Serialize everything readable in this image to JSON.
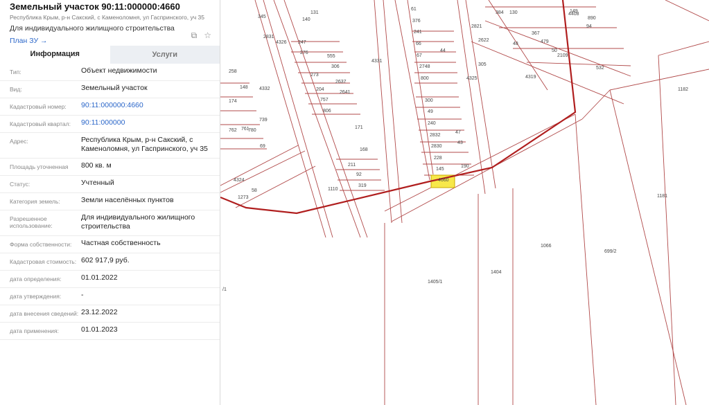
{
  "header": {
    "title": "Земельный участок 90:11:000000:4660",
    "address_short": "Республика Крым, р-н Сакский, с Каменоломня, ул Гаспринского, уч 35",
    "purpose": "Для индивидуального жилищного строительства",
    "plan_link": "План ЗУ →"
  },
  "tabs": [
    {
      "label": "Информация",
      "active": true
    },
    {
      "label": "Услуги",
      "active": false
    }
  ],
  "rows": [
    {
      "label": "Тип:",
      "value": "Объект недвижимости"
    },
    {
      "label": "Вид:",
      "value": "Земельный участок"
    },
    {
      "label": "Кадастровый номер:",
      "value": "90:11:000000:4660",
      "link": true
    },
    {
      "label": "Кадастровый квартал:",
      "value": "90:11:000000",
      "link": true
    },
    {
      "label": "Адрес:",
      "value": "Республика Крым, р-н Сакский, с Каменоломня, ул Гаспринского, уч 35"
    },
    {
      "label": "Площадь уточненная",
      "value": "800 кв. м"
    },
    {
      "label": "Статус:",
      "value": "Учтенный"
    },
    {
      "label": "Категория земель:",
      "value": "Земли населённых пунктов"
    },
    {
      "label": "Разрешенное использование:",
      "value": "Для индивидуального жилищного строительства"
    },
    {
      "label": "Форма собственности:",
      "value": "Частная собственность"
    },
    {
      "label": "Кадастровая стоимость:",
      "value": "602 917,9 руб."
    },
    {
      "label": "дата определения:",
      "value": "01.01.2022"
    },
    {
      "label": "дата утверждения:",
      "value": "-"
    },
    {
      "label": "дата внесения сведений:",
      "value": "23.12.2022"
    },
    {
      "label": "дата применения:",
      "value": "01.01.2023"
    }
  ],
  "map": {
    "parcel_labels": [
      "4331",
      "4325",
      "4319",
      "4326",
      "4332",
      "4324",
      "4408",
      "1182",
      "1181",
      "1066",
      "699/2",
      "1405/1",
      "1404",
      "1110",
      "1273",
      "58",
      "171",
      "168",
      "211",
      "92",
      "319",
      "300",
      "49",
      "240",
      "2832",
      "2830",
      "228",
      "145",
      "47",
      "43",
      "190",
      "4660",
      "44",
      "2748",
      "800",
      "67",
      "66",
      "241",
      "376",
      "61",
      "247",
      "276",
      "273",
      "204",
      "757",
      "806",
      "555",
      "306",
      "2637",
      "2641",
      "140",
      "131",
      "345",
      "2831",
      "258",
      "174",
      "148",
      "762",
      "761",
      "780",
      "69",
      "739",
      "2821",
      "2622",
      "384",
      "130",
      "48",
      "367",
      "479",
      "50",
      "2109",
      "532",
      "890",
      "94",
      "149",
      "305",
      "/1"
    ],
    "selected_parcel": "4660",
    "colors": {
      "boundary": "#b01e1e",
      "parcel_line": "#b04848",
      "highlight_fill": "#f7e84a"
    }
  }
}
